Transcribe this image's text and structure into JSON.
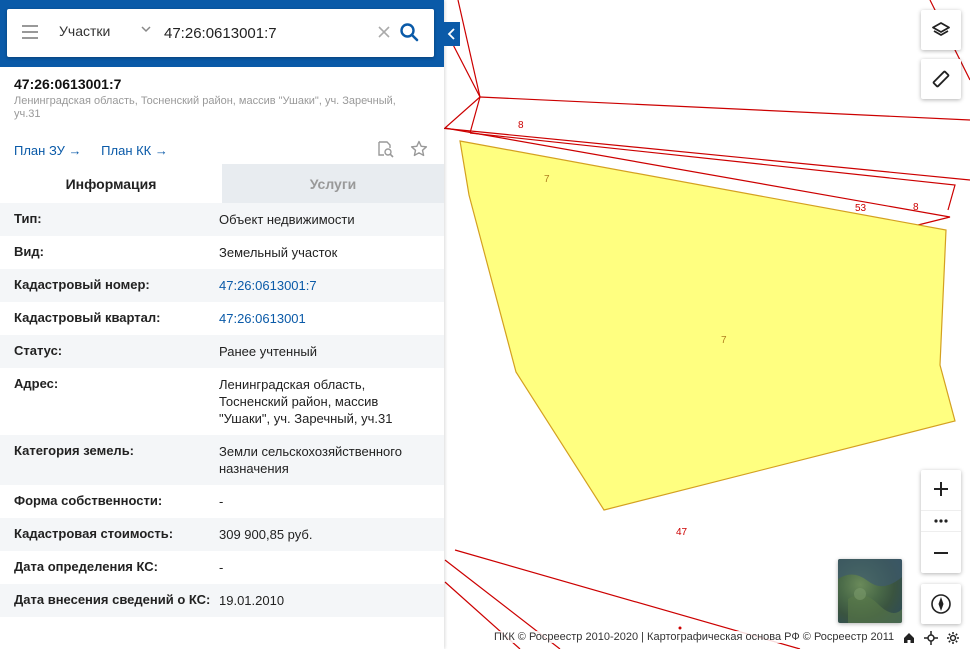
{
  "search": {
    "category": "Участки",
    "value": "47:26:0613001:7"
  },
  "object": {
    "title": "47:26:0613001:7",
    "address": "Ленинградская область, Тосненский район, массив \"Ушаки\", уч. Заречный, уч.31"
  },
  "plans": {
    "plan_zu": "План ЗУ →",
    "plan_kk": "План КК →"
  },
  "tabs": {
    "info": "Информация",
    "services": "Услуги"
  },
  "info": [
    {
      "label": "Тип:",
      "value": "Объект недвижимости"
    },
    {
      "label": "Вид:",
      "value": "Земельный участок"
    },
    {
      "label": "Кадастровый номер:",
      "value": "47:26:0613001:7"
    },
    {
      "label": "Кадастровый квартал:",
      "value": "47:26:0613001"
    },
    {
      "label": "Статус:",
      "value": "Ранее учтенный"
    },
    {
      "label": "Адрес:",
      "value": "Ленинградская область, Тосненский район, массив \"Ушаки\", уч. Заречный, уч.31"
    },
    {
      "label": "Категория земель:",
      "value": "Земли сельскохозяйственного назначения"
    },
    {
      "label": "Форма собственности:",
      "value": "-"
    },
    {
      "label": "Кадастровая стоимость:",
      "value": "309 900,85 руб."
    },
    {
      "label": "Дата определения КС:",
      "value": "-"
    },
    {
      "label": "Дата внесения сведений о КС:",
      "value": "19.01.2010"
    }
  ],
  "map": {
    "labels": [
      "8",
      "7",
      "53",
      "8",
      "7",
      "47"
    ],
    "attribution": "ПКК © Росреестр 2010-2020 | Картографическая основа РФ © Росреестр 2011"
  },
  "colors": {
    "header_blue": "#0a5aa8",
    "parcel_fill": "#ffff80",
    "boundary_red": "#cc0000"
  }
}
